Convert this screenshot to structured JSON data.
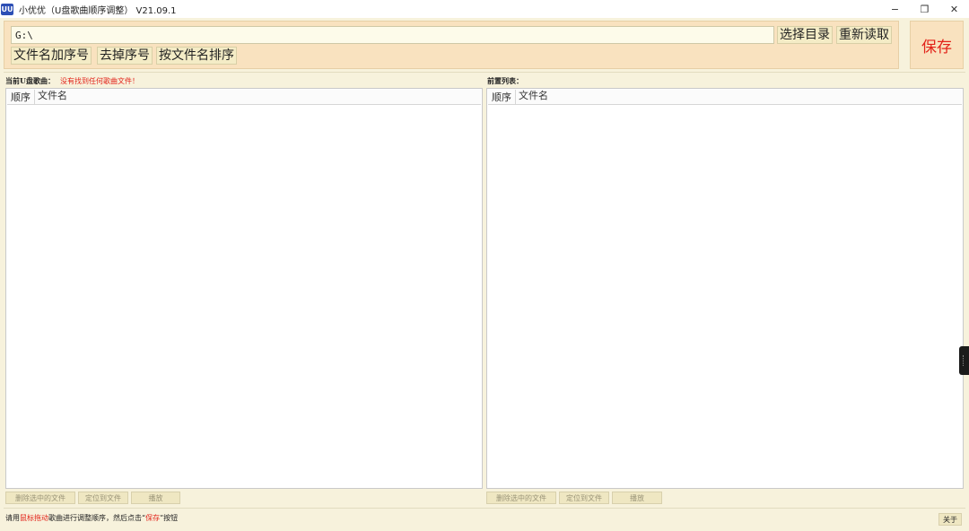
{
  "window": {
    "icon_text": "UU",
    "title": "小优优（U盘歌曲顺序调整） V21.09.1",
    "minimize_glyph": "−",
    "restore_glyph": "❐",
    "close_glyph": "✕"
  },
  "toolbar": {
    "path_value": "G:\\",
    "select_dir_label": "选择目录",
    "reload_label": "重新读取",
    "add_number_label": "文件名加序号",
    "remove_number_label": "去掉序号",
    "sort_by_name_label": "按文件名排序",
    "save_label": "保存"
  },
  "left_pane": {
    "label": "当前U盘歌曲：",
    "warning": "没有找到任何歌曲文件！",
    "columns": [
      "顺序",
      "文件名"
    ],
    "rows": [],
    "delete_label": "删除选中的文件",
    "locate_label": "定位到文件",
    "play_label": "播放"
  },
  "right_pane": {
    "label": "前置列表：",
    "columns": [
      "顺序",
      "文件名"
    ],
    "rows": [],
    "delete_label": "删除选中的文件",
    "locate_label": "定位到文件",
    "play_label": "播放"
  },
  "status": {
    "part1": "请用",
    "highlight1": "鼠标拖动",
    "part2": "歌曲进行调整顺序，然后点击“",
    "highlight2": "保存",
    "part3": "”按钮"
  },
  "about_label": "关于",
  "colors": {
    "background": "#f7f2dc",
    "toolbar_bg": "#f9e2bf",
    "save_text": "#e2231a",
    "warning_text": "#e2231a",
    "app_icon_bg": "#2d4fb5"
  }
}
